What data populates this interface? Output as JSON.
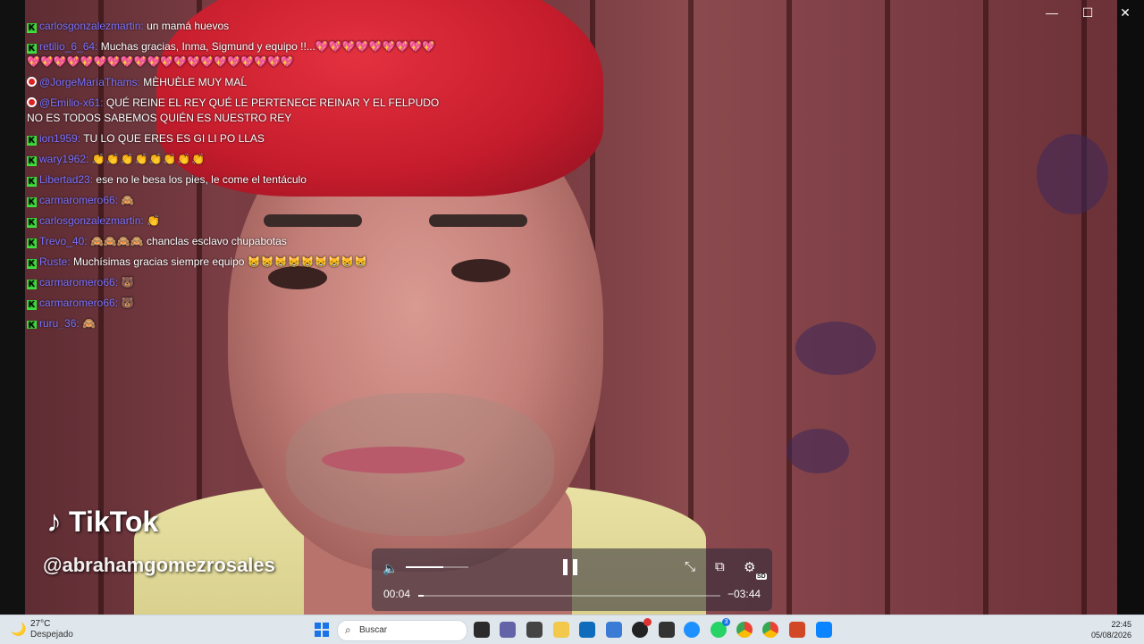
{
  "window": {
    "minimize_glyph": "—",
    "maximize_glyph": "☐",
    "close_glyph": "✕"
  },
  "chat": {
    "messages": [
      {
        "platform": "kick",
        "user": "carlosgonzalezmartin",
        "text": "un mamá huevos"
      },
      {
        "platform": "kick",
        "user": "retilio_6_64",
        "text": "Muchas gracias, Inma, Sigmund y equipo !!...💖💖💖💖💖💖💖💖💖💖💖💖💖💖💖💖💖💖💖💖💖💖💖💖💖💖💖💖💖"
      },
      {
        "platform": "youtube",
        "user": "@JorgeMaríaThams",
        "text": "MÈHUÈLE MUY MAĹ"
      },
      {
        "platform": "youtube",
        "user": "@Emilio-x61",
        "text": "QUÉ REINE EL REY QUÉ LE PERTENECE REINAR Y EL FELPUDO NO ES TODOS SABEMOS QUIÉN ES NUESTRO REY"
      },
      {
        "platform": "kick",
        "user": "ion1959",
        "text": "TU LO QUE ERES ES GI LI PO LLAS"
      },
      {
        "platform": "kick",
        "user": "wary1962",
        "text": "👏👏👏👏👏👏👏👏"
      },
      {
        "platform": "kick",
        "user": "Libertad23",
        "text": "ese no le besa los pies, le come el tentáculo"
      },
      {
        "platform": "kick",
        "user": "carmaromero66",
        "text": "🙈"
      },
      {
        "platform": "kick",
        "user": "carlosgonzalezmartin",
        "text": "👏"
      },
      {
        "platform": "kick",
        "user": "Trevo_40",
        "text": "🙈🙈🙈🙈 chanclas esclavo chupabotas"
      },
      {
        "platform": "kick",
        "user": "Ruste",
        "text": "Muchísimas gracias siempre equipo 😸😸😸😸😸😸😸😸😸"
      },
      {
        "platform": "kick",
        "user": "carmaromero66",
        "text": "🐻"
      },
      {
        "platform": "kick",
        "user": "carmaromero66",
        "text": "🐻"
      },
      {
        "platform": "kick",
        "user": "ruru_36",
        "text": "🙈"
      }
    ]
  },
  "watermark": {
    "brand": "TikTok",
    "handle": "@abrahamgomezrosales"
  },
  "player": {
    "current_time": "00:04",
    "remaining_time": "−03:44",
    "progress_fraction": 0.018,
    "volume_fraction": 0.6,
    "quality_badge": "SD"
  },
  "taskbar": {
    "weather_temp": "27°C",
    "weather_desc": "Despejado",
    "search_placeholder": "Buscar",
    "time": "22:45",
    "date": "05/08/2026",
    "teams_badge": "3"
  },
  "colors": {
    "accent_blue": "#1a73e8",
    "kick_green": "#3ee33e",
    "username_purple": "#7d73ff"
  }
}
